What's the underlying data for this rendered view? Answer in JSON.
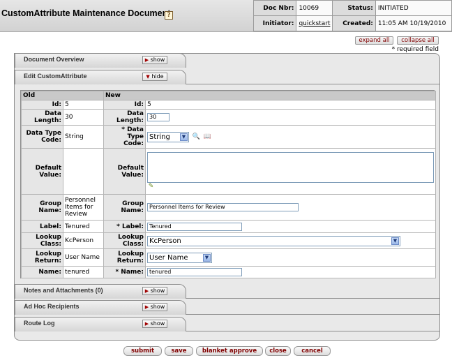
{
  "header": {
    "title": "CustomAttribute Maintenance Document",
    "help_glyph": "?",
    "doc_nbr_label": "Doc Nbr:",
    "doc_nbr": "10069",
    "status_label": "Status:",
    "status": "INITIATED",
    "initiator_label": "Initiator:",
    "initiator": "quickstart",
    "created_label": "Created:",
    "created": "11:05 AM 10/19/2010"
  },
  "controls": {
    "expand_all": "expand all",
    "collapse_all": "collapse all",
    "required_note": "* required field"
  },
  "tabs": {
    "overview": {
      "title": "Document Overview",
      "button": "show"
    },
    "edit": {
      "title": "Edit CustomAttribute",
      "button": "hide"
    },
    "notes": {
      "title": "Notes and Attachments (0)",
      "button": "show"
    },
    "adhoc": {
      "title": "Ad Hoc Recipients",
      "button": "show"
    },
    "routelog": {
      "title": "Route Log",
      "button": "show"
    }
  },
  "grid": {
    "old_header": "Old",
    "new_header": "New",
    "id": {
      "label": "Id:",
      "old": "5",
      "new": "5"
    },
    "data_length": {
      "label": "Data Length:",
      "old": "30",
      "new": "30"
    },
    "data_type_code": {
      "label": "Data Type Code:",
      "req_label": "* Data Type Code:",
      "old": "String",
      "new": "String"
    },
    "default_value": {
      "label": "Default Value:",
      "old": "",
      "new": ""
    },
    "group_name": {
      "label": "Group Name:",
      "old": "Personnel Items for Review",
      "new": "Personnel Items for Review"
    },
    "label": {
      "label": "Label:",
      "req_label": "* Label:",
      "old": "Tenured",
      "new": "Tenured"
    },
    "lookup_class": {
      "label": "Lookup Class:",
      "old": "KcPerson",
      "new": "KcPerson"
    },
    "lookup_return": {
      "label": "Lookup Return:",
      "old": "User Name",
      "new": "User Name"
    },
    "name": {
      "label": "Name:",
      "req_label": "* Name:",
      "old": "tenured",
      "new": "tenured"
    }
  },
  "actions": {
    "submit": "submit",
    "save": "save",
    "blanket_approve": "blanket approve",
    "close": "close",
    "cancel": "cancel"
  }
}
